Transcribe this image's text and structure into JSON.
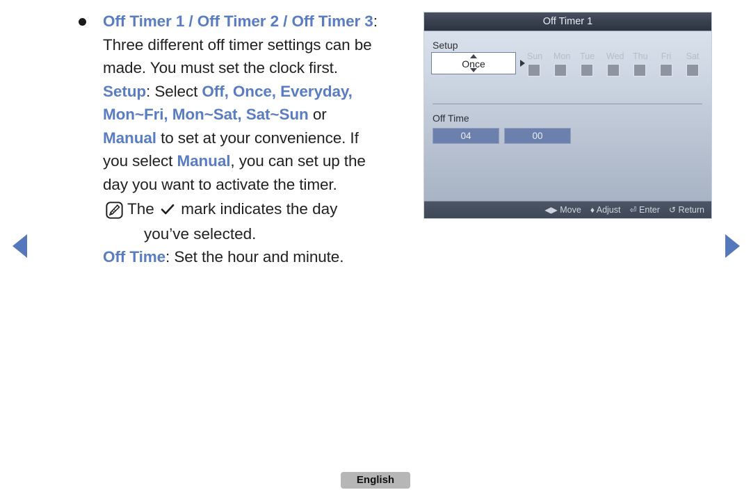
{
  "nav": {
    "prev_label": "previous page",
    "next_label": "next page"
  },
  "content": {
    "heading": "Off Timer 1 / Off Timer 2 / Off Timer 3",
    "heading_suffix": ":",
    "body_line1": "Three different off timer settings can be",
    "body_line2": "made. You must set the clock first.",
    "setup_term": "Setup",
    "setup_colon": ": Select ",
    "setup_options": "Off, Once, Everyday,",
    "setup_options2": "Mon~Fri, Mon~Sat, Sat~Sun",
    "setup_or": " or",
    "manual_term": "Manual",
    "manual_rest": " to set at your convenience. If",
    "manual_line2_pre": "you select ",
    "manual_line2_term": "Manual",
    "manual_line2_post": ", you can set up the",
    "manual_line3": "day you want to activate the timer.",
    "note_pre": "The ",
    "note_check": "✓",
    "note_post": " mark indicates the day",
    "note_line2": "you’ve selected.",
    "offtime_term": "Off Time",
    "offtime_rest": ": Set the hour and minute."
  },
  "osd": {
    "title": "Off Timer 1",
    "setup_label": "Setup",
    "setup_value": "Once",
    "days": [
      {
        "label": "Sun",
        "checked": false
      },
      {
        "label": "Mon",
        "checked": false
      },
      {
        "label": "Tue",
        "checked": false
      },
      {
        "label": "Wed",
        "checked": false
      },
      {
        "label": "Thu",
        "checked": false
      },
      {
        "label": "Fri",
        "checked": false
      },
      {
        "label": "Sat",
        "checked": false
      }
    ],
    "offtime_label": "Off Time",
    "hour_value": "04",
    "minute_value": "00",
    "footer": {
      "move_glyph": "◀▶",
      "move_label": "Move",
      "adjust_glyph": "♦",
      "adjust_label": "Adjust",
      "enter_glyph": "⏎",
      "enter_label": "Enter",
      "return_glyph": "↺",
      "return_label": "Return"
    }
  },
  "footer": {
    "language_label": "English"
  },
  "colors": {
    "accent_blue": "#5a7cc2",
    "osd_value_blue": "#6b80ad",
    "nav_arrow": "#5577bb"
  }
}
